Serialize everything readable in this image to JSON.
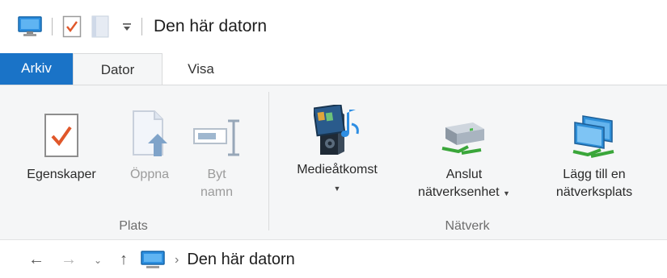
{
  "window": {
    "title": "Den här datorn"
  },
  "quick_access": {
    "icons": [
      "computer-icon",
      "properties-icon",
      "new-folder-icon",
      "customize-quick-access-icon"
    ]
  },
  "tabs": [
    {
      "label": "Arkiv"
    },
    {
      "label": "Dator"
    },
    {
      "label": "Visa"
    }
  ],
  "ribbon": {
    "groups": [
      {
        "label": "Plats",
        "buttons": [
          {
            "label": "Egenskaper",
            "icon": "properties-icon",
            "enabled": true
          },
          {
            "label": "Öppna",
            "icon": "open-icon",
            "enabled": false
          },
          {
            "label_line1": "Byt",
            "label_line2": "namn",
            "icon": "rename-icon",
            "enabled": false
          }
        ]
      },
      {
        "label": "Nätverk",
        "buttons": [
          {
            "label": "Medieåtkomst",
            "icon": "media-access-icon",
            "enabled": true,
            "dropdown": true
          },
          {
            "label_line1": "Anslut",
            "label_line2": "nätverksenhet",
            "icon": "network-drive-icon",
            "enabled": true,
            "dropdown": true
          },
          {
            "label_line1": "Lägg till en",
            "label_line2": "nätverksplats",
            "icon": "network-location-icon",
            "enabled": true
          }
        ]
      }
    ]
  },
  "address_bar": {
    "breadcrumb": "Den här datorn",
    "colors": {
      "accent": "#1a73c7"
    }
  }
}
